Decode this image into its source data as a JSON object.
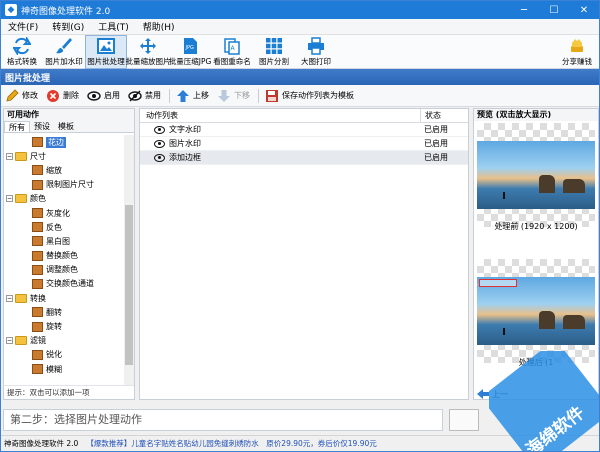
{
  "window": {
    "title": "神奇图像处理软件 2.0",
    "min": "─",
    "max": "☐",
    "close": "✕"
  },
  "menu": [
    "文件(F)",
    "转到(G)",
    "工具(T)",
    "帮助(H)"
  ],
  "toolbar": {
    "items": [
      {
        "label": "格式转换",
        "icon": "convert-icon",
        "color": "#1a7fd4"
      },
      {
        "label": "图片加水印",
        "icon": "brush-icon",
        "color": "#1a7fd4"
      },
      {
        "label": "图片批处理",
        "icon": "image-icon",
        "color": "#1a7fd4",
        "active": true
      },
      {
        "label": "批量缩放图片",
        "icon": "move-arrows-icon",
        "color": "#1a7fd4"
      },
      {
        "label": "批量压缩JPG",
        "icon": "jpg-file-icon",
        "color": "#1a7fd4"
      },
      {
        "label": "看图重命名",
        "icon": "rename-icon",
        "color": "#1a7fd4"
      },
      {
        "label": "图片分割",
        "icon": "grid-icon",
        "color": "#1a7fd4"
      },
      {
        "label": "大图打印",
        "icon": "printer-icon",
        "color": "#1a7fd4"
      }
    ],
    "share": {
      "label": "分享赚钱",
      "icon": "gold-coins-icon"
    }
  },
  "section_title": "图片批处理",
  "actions": [
    {
      "label": "修改",
      "icon": "pencil-icon",
      "enabled": true
    },
    {
      "label": "删除",
      "icon": "delete-icon",
      "enabled": true
    },
    {
      "label": "启用",
      "icon": "eye-icon",
      "enabled": true
    },
    {
      "label": "禁用",
      "icon": "eye-off-icon",
      "enabled": true
    },
    {
      "label": "上移",
      "icon": "arrow-up-icon",
      "enabled": true
    },
    {
      "label": "下移",
      "icon": "arrow-down-icon",
      "enabled": false
    },
    {
      "label": "保存动作列表为模板",
      "icon": "save-template-icon",
      "enabled": true
    }
  ],
  "left_panel": {
    "title": "可用动作",
    "tabs": [
      "所有",
      "预设",
      "模板"
    ],
    "tree": [
      {
        "label": "花边",
        "type": "item",
        "selected": true
      },
      {
        "label": "尺寸",
        "type": "folder"
      },
      {
        "label": "缩放",
        "type": "item"
      },
      {
        "label": "限制图片尺寸",
        "type": "item"
      },
      {
        "label": "颜色",
        "type": "folder"
      },
      {
        "label": "灰度化",
        "type": "item"
      },
      {
        "label": "反色",
        "type": "item"
      },
      {
        "label": "黑白图",
        "type": "item"
      },
      {
        "label": "替换颜色",
        "type": "item"
      },
      {
        "label": "调整颜色",
        "type": "item"
      },
      {
        "label": "交换颜色通道",
        "type": "item"
      },
      {
        "label": "转换",
        "type": "folder"
      },
      {
        "label": "翻转",
        "type": "item"
      },
      {
        "label": "旋转",
        "type": "item"
      },
      {
        "label": "滤镜",
        "type": "folder"
      },
      {
        "label": "锐化",
        "type": "item"
      },
      {
        "label": "模糊",
        "type": "item"
      }
    ],
    "hint": "提示：双击可以添加一项"
  },
  "mid_panel": {
    "col_action": "动作列表",
    "col_status": "状态",
    "rows": [
      {
        "name": "文字水印",
        "status": "已启用"
      },
      {
        "name": "图片水印",
        "status": "已启用"
      },
      {
        "name": "添加边框",
        "status": "已启用",
        "selected": true
      }
    ]
  },
  "right_panel": {
    "title": "预览 (双击放大显示)",
    "before_caption": "处理前 (1920 x 1200)",
    "after_caption": "处理后 (1",
    "nav_label": "上一"
  },
  "step_text": "第二步：选择图片处理动作",
  "status": {
    "app": "神奇图像处理软件 2.0",
    "promo": "【爆款推荐】儿童名字贴姓名贴幼儿园免缝刺绣防水　原价29.90元，券后价仅19.90元"
  },
  "watermark_text": "海绵软件"
}
